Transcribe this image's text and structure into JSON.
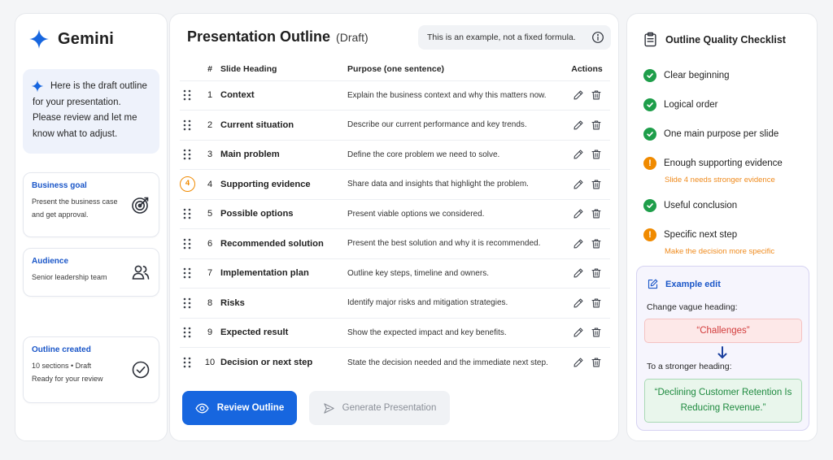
{
  "brand": {
    "name": "Gemini"
  },
  "assistant_message": "Here is the draft outline for your presentation. Please review and let me know what to adjust.",
  "cards": {
    "goal": {
      "title": "Business goal",
      "body": "Present the business case and get approval."
    },
    "audience": {
      "title": "Audience",
      "body": "Senior leadership team"
    },
    "created": {
      "title": "Outline created",
      "line1": "10 sections • Draft",
      "line2": "Ready for your review"
    }
  },
  "outline": {
    "title": "Presentation Outline",
    "status": "(Draft)",
    "notice": "This is an example, not a fixed formula.",
    "columns": {
      "num": "#",
      "heading": "Slide Heading",
      "purpose": "Purpose (one sentence)",
      "actions": "Actions"
    },
    "rows": [
      {
        "num": "1",
        "heading": "Context",
        "purpose": "Explain the business context and why this matters now.",
        "flag": ""
      },
      {
        "num": "2",
        "heading": "Current situation",
        "purpose": "Describe our current performance and key trends.",
        "flag": ""
      },
      {
        "num": "3",
        "heading": "Main problem",
        "purpose": "Define the core problem we need to solve.",
        "flag": ""
      },
      {
        "num": "4",
        "heading": "Supporting evidence",
        "purpose": "Share data and insights that highlight the problem.",
        "flag": "4"
      },
      {
        "num": "5",
        "heading": "Possible options",
        "purpose": "Present viable options we considered.",
        "flag": ""
      },
      {
        "num": "6",
        "heading": "Recommended solution",
        "purpose": "Present the best solution and why it is recommended.",
        "flag": ""
      },
      {
        "num": "7",
        "heading": "Implementation plan",
        "purpose": "Outline key steps, timeline and owners.",
        "flag": ""
      },
      {
        "num": "8",
        "heading": "Risks",
        "purpose": "Identify major risks and mitigation strategies.",
        "flag": ""
      },
      {
        "num": "9",
        "heading": "Expected result",
        "purpose": "Show the expected impact and key benefits.",
        "flag": ""
      },
      {
        "num": "10",
        "heading": "Decision or next step",
        "purpose": "State the decision needed and the immediate next step.",
        "flag": ""
      }
    ],
    "buttons": {
      "review": "Review Outline",
      "generate": "Generate Presentation"
    }
  },
  "checklist": {
    "title": "Outline Quality Checklist",
    "items": [
      {
        "label": "Clear beginning",
        "status": "ok",
        "note": ""
      },
      {
        "label": "Logical order",
        "status": "ok",
        "note": ""
      },
      {
        "label": "One main purpose per slide",
        "status": "ok",
        "note": ""
      },
      {
        "label": "Enough supporting evidence",
        "status": "warn",
        "note": "Slide 4 needs stronger evidence"
      },
      {
        "label": "Useful conclusion",
        "status": "ok",
        "note": ""
      },
      {
        "label": "Specific next step",
        "status": "warn",
        "note": "Make the decision more specific"
      }
    ],
    "colors": {
      "ok": "#1e9e4a",
      "warn": "#f08a00",
      "accent": "#1766df"
    }
  },
  "example_edit": {
    "title": "Example edit",
    "label_before": "Change vague heading:",
    "bad": "“Challenges”",
    "label_after": "To a stronger heading:",
    "good": "“Declining Customer Retention Is Reducing Revenue.”"
  }
}
